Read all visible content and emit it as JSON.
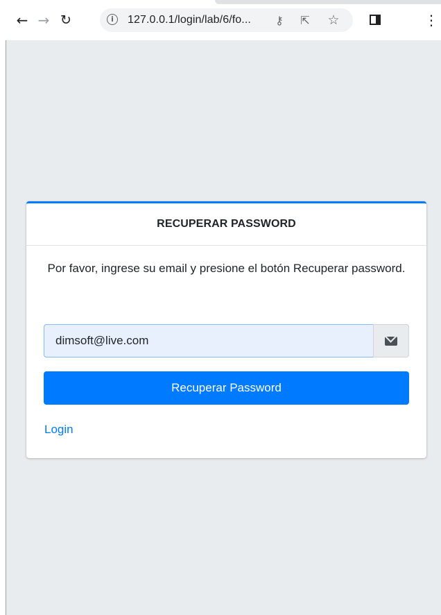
{
  "browser": {
    "url": "127.0.0.1/login/lab/6/fo...",
    "icons": {
      "back": "arrow-left-icon",
      "forward": "arrow-right-icon",
      "reload": "reload-icon",
      "site_info": "info-icon",
      "password_key": "key-icon",
      "share": "share-icon",
      "bookmark": "star-icon",
      "side_panel": "side-panel-icon",
      "menu": "kebab-menu-icon"
    }
  },
  "page": {
    "background_color": "#e9ecef",
    "accent_color": "#007bff"
  },
  "card": {
    "title": "RECUPERAR PASSWORD",
    "message": "Por favor, ingrese su email y presione el botón Recuperar password.",
    "email_value": "dimsoft@live.com",
    "email_icon": "envelope-icon",
    "submit_label": "Recuperar Password",
    "login_link": "Login"
  }
}
